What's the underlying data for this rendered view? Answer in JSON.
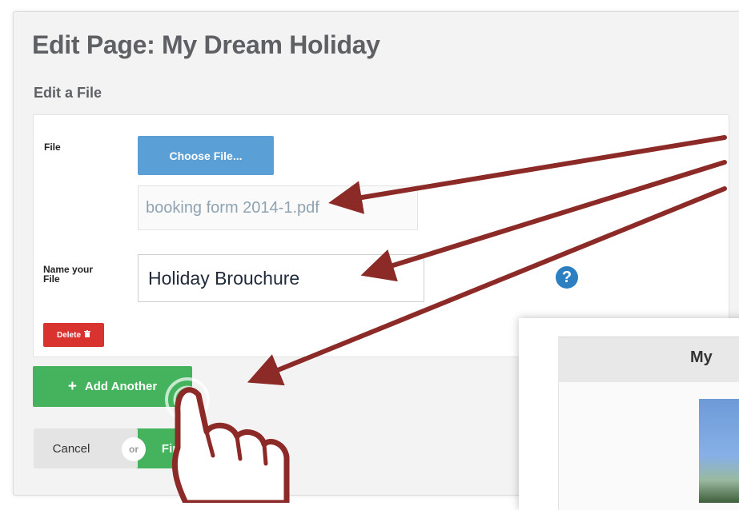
{
  "page": {
    "title": "Edit Page: My Dream Holiday",
    "section_title": "Edit a File"
  },
  "form": {
    "file_label": "File",
    "choose_file_label": "Choose File...",
    "selected_file": "booking form 2014-1.pdf",
    "name_label_line1": "Name your",
    "name_label_line2": "File",
    "name_value": "Holiday Brouchure",
    "help_glyph": "?",
    "delete_label": "Delete",
    "delete_icon_glyph": "🗑"
  },
  "actions": {
    "add_another_plus": "+",
    "add_another_label": "Add Another",
    "cancel_label": "Cancel",
    "or_label": "or",
    "finish_label": "Finish"
  },
  "preview": {
    "title": "My"
  },
  "colors": {
    "primary_blue": "#5a9fd6",
    "success_green": "#45b35e",
    "danger_red": "#d9332f",
    "help_blue": "#2c7fc1",
    "annotation_arrow": "#8b2a26"
  },
  "icons": [
    "question-circle-icon",
    "trash-icon",
    "plus-icon",
    "pointing-hand-cursor-icon",
    "arrow-annotation-icon"
  ]
}
